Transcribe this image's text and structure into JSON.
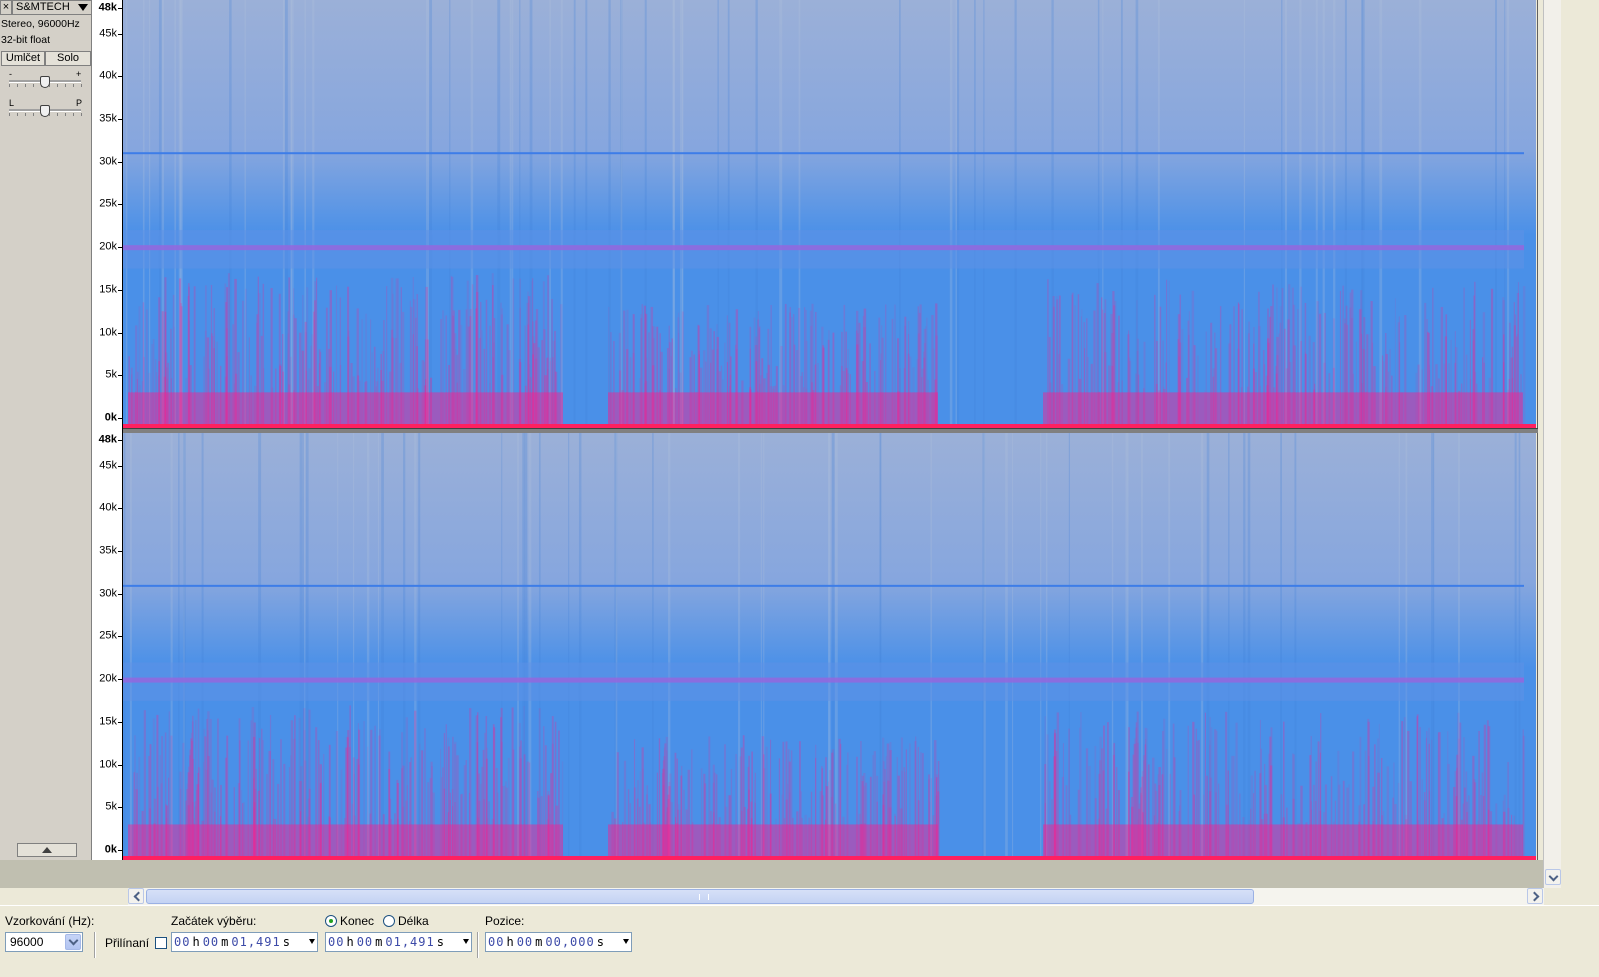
{
  "track": {
    "close_glyph": "×",
    "name": "S&MTECH",
    "info_line1": "Stereo, 96000Hz",
    "info_line2": "32-bit float",
    "mute_label": "Umlčet",
    "solo_label": "Solo",
    "gain_minus": "-",
    "gain_plus": "+",
    "pan_left": "L",
    "pan_right": "P",
    "gain_level": 0.5,
    "pan_level": 0.5
  },
  "ruler": {
    "labels": [
      "48k",
      "45k",
      "40k",
      "35k",
      "30k",
      "25k",
      "20k",
      "15k",
      "10k",
      "5k",
      "0k"
    ]
  },
  "selection_bar": {
    "rate_label": "Vzorkování (Hz):",
    "rate_value": "96000",
    "snap_label": "Přilínaní",
    "snap_checked": false,
    "start_label": "Začátek výběru:",
    "end_option_label": "Konec",
    "length_option_label": "Délka",
    "end_selected": true,
    "position_label": "Pozice:",
    "start_time": {
      "h": "00",
      "h_unit": "h",
      "m": "00",
      "m_unit": "m",
      "s": "01,491",
      "s_unit": "s"
    },
    "end_time": {
      "h": "00",
      "h_unit": "h",
      "m": "00",
      "m_unit": "m",
      "s": "01,491",
      "s_unit": "s"
    },
    "position_time": {
      "h": "00",
      "h_unit": "h",
      "m": "00",
      "m_unit": "m",
      "s": "00,000",
      "s_unit": "s"
    }
  },
  "colors": {
    "spectrogram_background": "#4a90e8",
    "spectrogram_high_freq": "#9bb0d8",
    "spectrogram_energy": "#ff1a8c",
    "spectrogram_line": "#c83cd6"
  }
}
